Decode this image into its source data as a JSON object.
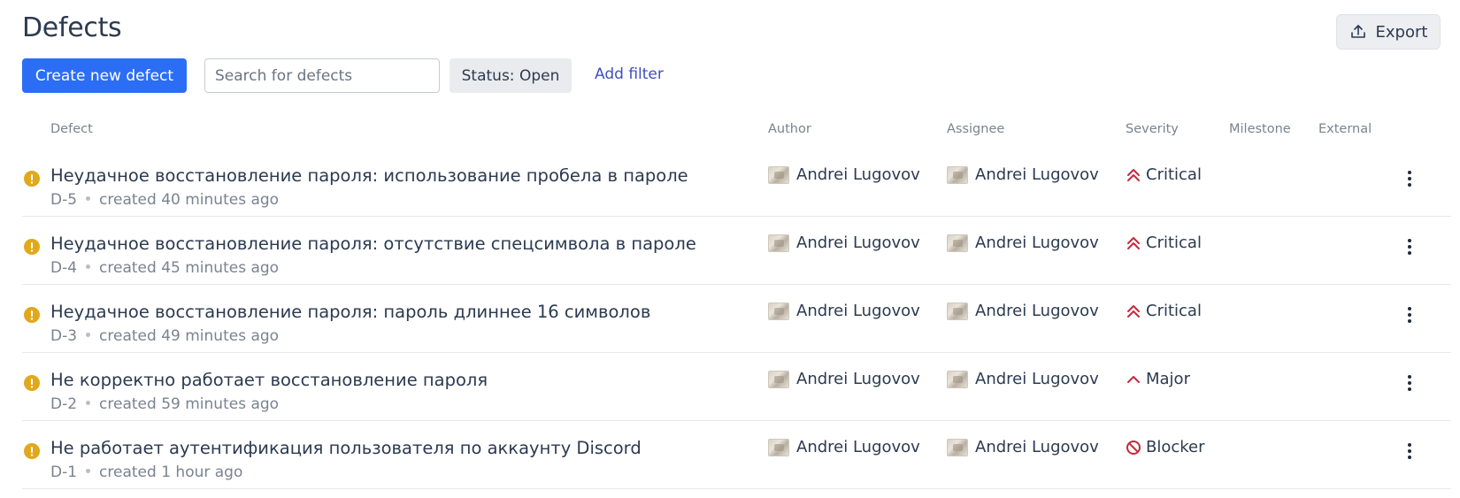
{
  "header": {
    "title": "Defects",
    "export_label": "Export"
  },
  "toolbar": {
    "create_label": "Create new defect",
    "search_placeholder": "Search for defects",
    "status_filter": "Status: Open",
    "add_filter_label": "Add filter"
  },
  "columns": {
    "defect": "Defect",
    "author": "Author",
    "assignee": "Assignee",
    "severity": "Severity",
    "milestone": "Milestone",
    "external": "External"
  },
  "colors": {
    "primary": "#2b6ef5",
    "link": "#3f4fc4",
    "status_open": "#e0a81c",
    "severity_red": "#c8283c"
  },
  "defects": [
    {
      "title": "Неудачное восстановление пароля: использование пробела в пароле",
      "id": "D-5",
      "created": "created 40 minutes ago",
      "author": "Andrei Lugovov",
      "assignee": "Andrei Lugovov",
      "severity": "Critical",
      "severity_icon": "double-chevron-up-icon"
    },
    {
      "title": "Неудачное восстановление пароля: отсутствие спецсимвола в пароле",
      "id": "D-4",
      "created": "created 45 minutes ago",
      "author": "Andrei Lugovov",
      "assignee": "Andrei Lugovov",
      "severity": "Critical",
      "severity_icon": "double-chevron-up-icon"
    },
    {
      "title": "Неудачное восстановление пароля: пароль длиннее 16 символов",
      "id": "D-3",
      "created": "created 49 minutes ago",
      "author": "Andrei Lugovov",
      "assignee": "Andrei Lugovov",
      "severity": "Critical",
      "severity_icon": "double-chevron-up-icon"
    },
    {
      "title": "Не корректно работает восстановление пароля",
      "id": "D-2",
      "created": "created 59 minutes ago",
      "author": "Andrei Lugovov",
      "assignee": "Andrei Lugovov",
      "severity": "Major",
      "severity_icon": "chevron-up-icon"
    },
    {
      "title": "Не работает аутентификация пользователя по аккаунту Discord",
      "id": "D-1",
      "created": "created 1 hour ago",
      "author": "Andrei Lugovov",
      "assignee": "Andrei Lugovov",
      "severity": "Blocker",
      "severity_icon": "blocked-icon"
    }
  ]
}
